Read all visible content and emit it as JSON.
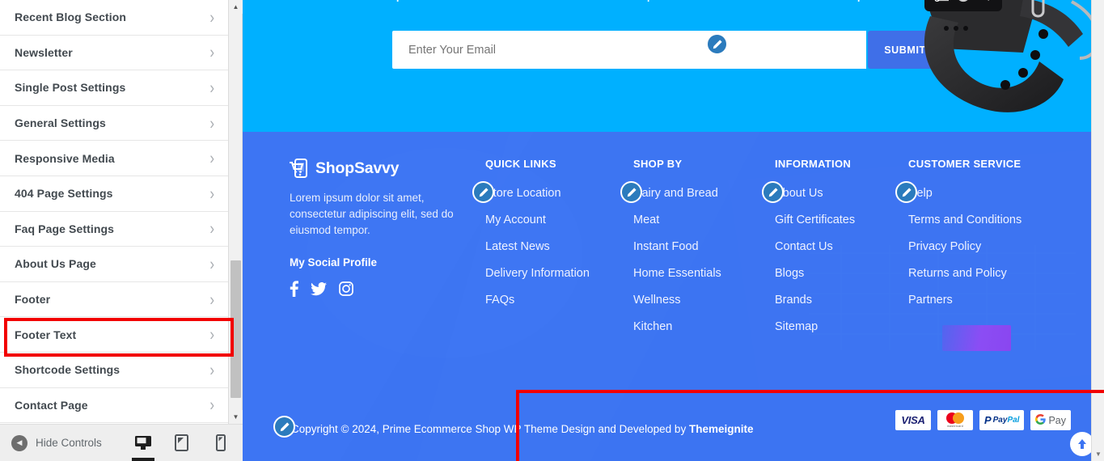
{
  "sidebar": {
    "items": [
      {
        "label": "Recent Blog Section",
        "icon": "chevron-right-icon"
      },
      {
        "label": "Newsletter",
        "icon": "chevron-right-icon"
      },
      {
        "label": "Single Post Settings",
        "icon": "chevron-right-icon"
      },
      {
        "label": "General Settings",
        "icon": "chevron-right-icon"
      },
      {
        "label": "Responsive Media",
        "icon": "chevron-right-icon"
      },
      {
        "label": "404 Page Settings",
        "icon": "chevron-right-icon"
      },
      {
        "label": "Faq Page Settings",
        "icon": "chevron-right-icon"
      },
      {
        "label": "About Us Page",
        "icon": "chevron-right-icon"
      },
      {
        "label": "Footer",
        "icon": "chevron-right-icon"
      },
      {
        "label": "Footer Text",
        "icon": "chevron-right-icon"
      },
      {
        "label": "Shortcode Settings",
        "icon": "chevron-right-icon"
      },
      {
        "label": "Contact Page",
        "icon": "chevron-right-icon"
      }
    ],
    "chevron": "›",
    "highlight_color": "#f20000",
    "highlighted_item": "Footer Text"
  },
  "controls_bar": {
    "hide_controls_label": "Hide Controls",
    "collapse_icon": "caret-left-icon",
    "devices": [
      {
        "name": "desktop-preview-icon",
        "active": true
      },
      {
        "name": "tablet-preview-icon",
        "active": false
      },
      {
        "name": "mobile-preview-icon",
        "active": false
      }
    ]
  },
  "newsletter": {
    "placeholder": "Enter Your Email",
    "value": "",
    "submit_label": "SUBMIT",
    "edit_icon": "edit-pencil-icon",
    "band_color": "#00b0ff",
    "submit_color": "#3f6fe8",
    "product_image": "smartwatch-image"
  },
  "footer": {
    "background_color": "#3c74f2",
    "brand": {
      "logo_icon": "shopping-cart-phone-icon",
      "name": "ShopSavvy",
      "description": "Lorem ipsum dolor sit amet, consectetur adipiscing elit, sed do eiusmod tempor.",
      "social_title": "My Social Profile",
      "social": [
        {
          "name": "facebook-icon"
        },
        {
          "name": "twitter-icon"
        },
        {
          "name": "instagram-icon"
        }
      ]
    },
    "columns": [
      {
        "title": "QUICK LINKS",
        "edit_icon": "edit-pencil-icon",
        "links": [
          "Store Location",
          "My Account",
          "Latest News",
          "Delivery Information",
          "FAQs"
        ]
      },
      {
        "title": "SHOP BY",
        "edit_icon": "edit-pencil-icon",
        "links": [
          "Dairy and Bread",
          "Meat",
          "Instant Food",
          "Home Essentials",
          "Wellness",
          "Kitchen"
        ]
      },
      {
        "title": "INFORMATION",
        "edit_icon": "edit-pencil-icon",
        "links": [
          "Gift Certificates",
          "Contact Us",
          "Blogs",
          "Brands",
          "Sitemap"
        ],
        "first_link": "About Us"
      },
      {
        "title": "CUSTOMER SERVICE",
        "edit_icon": "edit-pencil-icon",
        "links": [
          "Terms and Conditions",
          "Privacy Policy",
          "Returns and Policy",
          "Partners"
        ],
        "first_link": "Help",
        "highlight_block_color": "#8b4df4"
      }
    ],
    "copyright": {
      "edit_icon": "edit-pencil-icon",
      "text": "Copyright © 2024, Prime Ecommerce Shop WP Theme Design and Developed by ",
      "brand": "Themeignite"
    },
    "payments": [
      {
        "name": "visa-icon",
        "label": "VISA"
      },
      {
        "name": "mastercard-icon",
        "label": "mastercard"
      },
      {
        "name": "paypal-icon",
        "label": "PayPal"
      },
      {
        "name": "google-pay-icon",
        "label": "Pay"
      }
    ],
    "scroll_top_icon": "arrow-up-icon"
  }
}
